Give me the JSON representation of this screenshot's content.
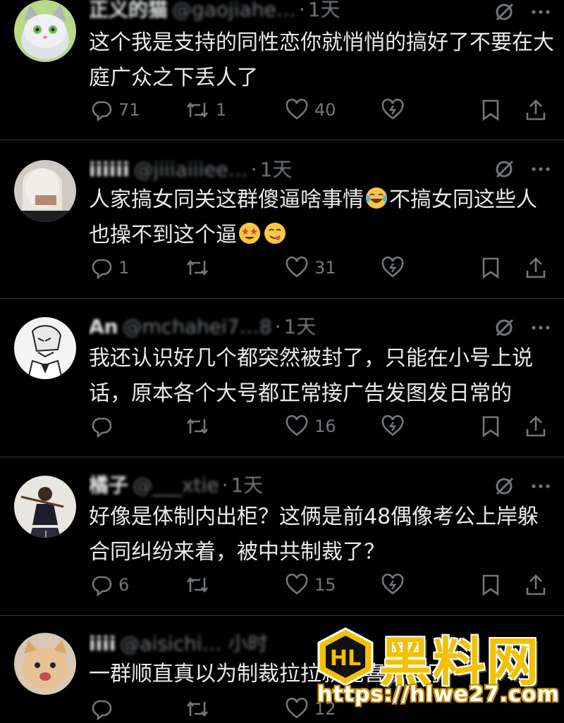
{
  "posts": [
    {
      "name": "正义的猫",
      "handle": "@gaojiahe…",
      "time": "1天",
      "text": "这个我是支持的同性恋你就悄悄的搞好了不要在大庭广众之下丢人了",
      "replies": "71",
      "reposts": "1",
      "likes": "40",
      "avatar": "cat-cartoon"
    },
    {
      "name": "iiiiii",
      "handle": "@jiiiaiiiee…",
      "time": "1天",
      "text_a": "人家搞女同关这群傻逼啥事情",
      "emoji_a": "laughing-crying-emoji",
      "text_b": "不搞女同这些人也操不到这个逼",
      "emoji_b1": "star-struck-emoji",
      "emoji_b2": "yum-face-emoji",
      "replies": "1",
      "reposts": "",
      "likes": "31",
      "avatar": "woman-photo"
    },
    {
      "name": "An",
      "handle": "@mchahei7…8",
      "time": "1天",
      "text": "我还认识好几个都突然被封了，只能在小号上说话，原本各个大号都正常接广告发图发日常的",
      "replies": "",
      "reposts": "",
      "likes": "16",
      "avatar": "anime-sketch"
    },
    {
      "name": "橘子",
      "handle": "@___xtie",
      "time": "1天",
      "text": "好像是体制内出柜？这俩是前48偶像考公上岸躲合同纠纷来着，被中共制裁了？",
      "replies": "6",
      "reposts": "",
      "likes": "15",
      "avatar": "girl-violin-photo"
    },
    {
      "name": "iiii",
      "handle": "@aisichi… 小时",
      "time": "",
      "text": "一群顺直真以为制裁拉拉就能喜欢你了",
      "replies": "",
      "reposts": "",
      "likes": "12",
      "avatar": "kitten-photo"
    }
  ],
  "icons": {
    "reply": "reply-icon",
    "repost": "repost-icon",
    "like": "heart-icon",
    "grok": "grok-icon",
    "bookmark": "bookmark-icon",
    "share": "share-icon",
    "mute": "mute-icon",
    "more": "more-icon"
  },
  "watermark": {
    "title": "黑料网",
    "url": "https://hlwe27.com",
    "logo_text": "HL"
  },
  "colors": {
    "background": "#000000",
    "text": "#e7e9ea",
    "muted": "#71767b",
    "brand": "#f2c200"
  }
}
